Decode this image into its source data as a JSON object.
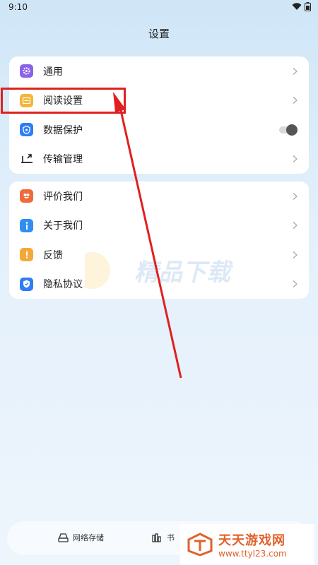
{
  "status": {
    "time": "9:10"
  },
  "title": "设置",
  "group1": [
    {
      "label": "通用",
      "icon": "gear-icon",
      "color": "#8a63e8",
      "control": "chevron"
    },
    {
      "label": "阅读设置",
      "icon": "book-icon",
      "color": "#f3b53a",
      "control": "chevron"
    },
    {
      "label": "数据保护",
      "icon": "shield-lock-icon",
      "color": "#2f7df6",
      "control": "toggle"
    },
    {
      "label": "传输管理",
      "icon": "transfer-icon",
      "color": "#222222",
      "control": "chevron"
    }
  ],
  "group2": [
    {
      "label": "评价我们",
      "icon": "flower-icon",
      "color": "#f06a3a",
      "control": "chevron"
    },
    {
      "label": "关于我们",
      "icon": "info-icon",
      "color": "#2f8ef0",
      "control": "chevron"
    },
    {
      "label": "反馈",
      "icon": "feedback-icon",
      "color": "#f3a93a",
      "control": "chevron"
    },
    {
      "label": "隐私协议",
      "icon": "privacy-shield-icon",
      "color": "#2f7df6",
      "control": "chevron"
    }
  ],
  "watermark": {
    "text": "精品下载"
  },
  "bottom_nav": [
    {
      "label": "网络存储",
      "icon": "cloud-drive-icon"
    },
    {
      "label": "书",
      "icon": "bookshelf-icon"
    }
  ],
  "logo": {
    "line1": "天天游戏网",
    "line2": "www.ttyl23.com"
  },
  "annotation_color": "#e02020"
}
